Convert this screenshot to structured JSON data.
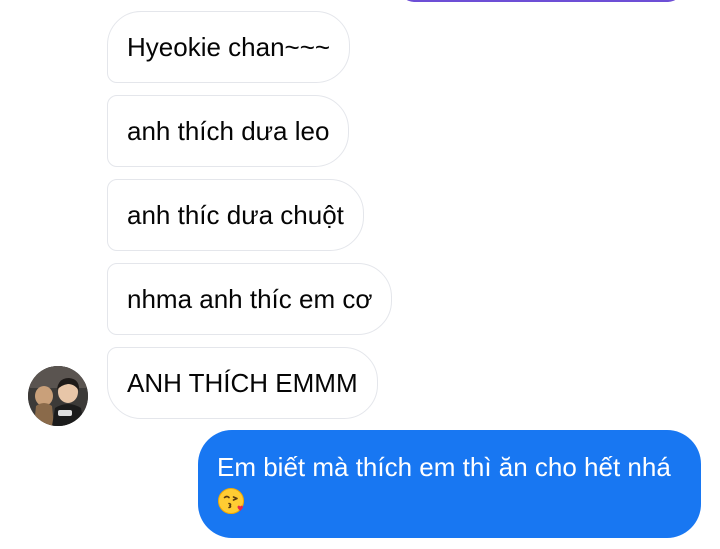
{
  "conversation": {
    "received_messages": [
      {
        "text": "Hyeokie chan~~~"
      },
      {
        "text": "anh thích dưa leo"
      },
      {
        "text": "anh thíc dưa chuột"
      },
      {
        "text": "nhma anh thíc em cơ"
      },
      {
        "text": "ANH THÍCH EMMM"
      }
    ],
    "sent_message": {
      "text": "Em biết mà thích em thì ăn cho hết nhá",
      "emoji": "kissing-face-with-heart-emoji"
    },
    "colors": {
      "sent_bubble": "#1877f2",
      "received_border": "#e4e6eb",
      "top_sent_bubble": "#6d4fd6",
      "text_dark": "#050505"
    }
  }
}
